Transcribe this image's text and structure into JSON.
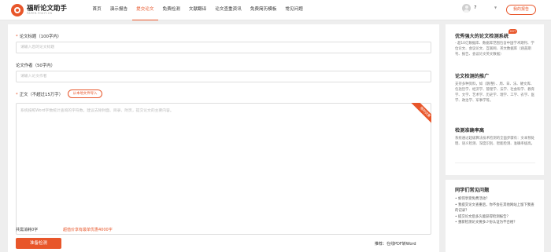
{
  "header": {
    "logo_name": "福昕论文助手",
    "logo_sub": "PAPER.FOXIT.CN",
    "nav": [
      {
        "label": "首页",
        "active": false
      },
      {
        "label": "演示报告",
        "active": false
      },
      {
        "label": "提交论文",
        "active": true
      },
      {
        "label": "免费检测",
        "active": false
      },
      {
        "label": "文献翻译",
        "active": false
      },
      {
        "label": "论文查重资讯",
        "active": false
      },
      {
        "label": "免费简历模板",
        "active": false
      },
      {
        "label": "常见问题",
        "active": false
      }
    ],
    "user_name": "7",
    "orders_label": "我的报告"
  },
  "form": {
    "title_label": "论文标题（100字内）",
    "title_placeholder": "请输入您的论文标题",
    "author_label": "论文作者（50字内）",
    "author_placeholder": "请输入论文作者",
    "body_label": "正文（不超过15万字）",
    "import_label": "从本地文件导入",
    "body_placeholder": "系统按照Word字数统计查询的字符数，建议去除封面、目录、附页，提交论文的主要内容。",
    "ribbon_label": "限时优惠",
    "word_count_prefix": "共需消耗",
    "word_count_value": "0",
    "word_count_suffix": "字",
    "promo_text": "超值价享有最单优惠4000字",
    "submit_label": "准备检测",
    "recommend_text": "推荐：在线PDF转Word"
  },
  "sidebar": {
    "hot_badge": "HOT",
    "sections": [
      {
        "title": "优秀强大的论文检测系统",
        "text": "- 超10亿数据库、数据库范围包含中国学术期刊、学位论文、会议论文、互联网、英文数据库（涵盖期刊、报告、会议论文英文数据）"
      },
      {
        "title": "论文检测的推广",
        "text": "支持多种资料，如（期/整）、周、日、法、硬文库、包括哲学、经济学、管理学、法学、社会科学、教育学、文学、艺术学、历史学、理学、工学、农学、医学、政治学、军事学等。"
      },
      {
        "title": "检测准确率高",
        "text": "系统通过超级算法技术检测的全面步骤有：文本预处理、语义检测、深度识别、智能检测、准确率极高。"
      }
    ],
    "faq_title": "同学们常见问题",
    "faq_items": [
      "• 如何享受免费活动？",
      "• 我提交论文查重后，你不会在其他网站上留下我查的记录？",
      "• 提交论文后多久能获得检测报告？",
      "• 重新检测论文要多少份认证为不合格？"
    ]
  }
}
